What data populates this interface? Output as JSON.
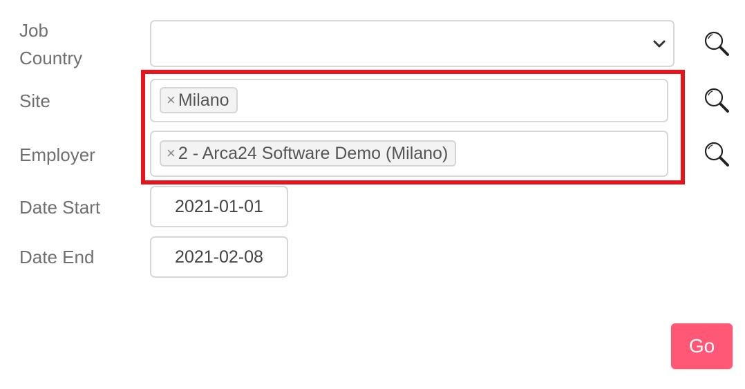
{
  "form": {
    "job_country": {
      "label": "Job\nCountry",
      "selected_value": ""
    },
    "site": {
      "label": "Site",
      "tags": [
        "Milano"
      ]
    },
    "employer": {
      "label": "Employer",
      "tags": [
        "2 - Arca24 Software Demo (Milano)"
      ]
    },
    "date_start": {
      "label": "Date Start",
      "value": "2021-01-01"
    },
    "date_end": {
      "label": "Date End",
      "value": "2021-02-08"
    },
    "tag_remove_glyph": "×",
    "go_label": "Go"
  },
  "colors": {
    "highlight": "#e8141c",
    "go_button": "#ff5876",
    "label_text": "#6f6f6f",
    "border": "#d7d7d7"
  },
  "icons": {
    "lookup": "search-icon",
    "dropdown": "chevron-down-icon"
  }
}
